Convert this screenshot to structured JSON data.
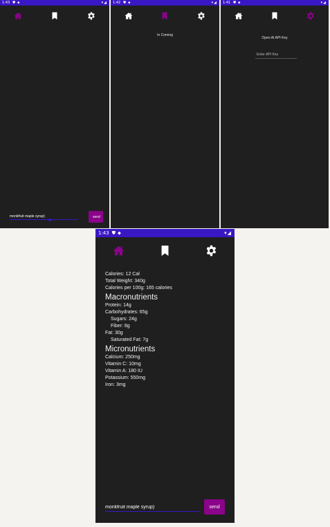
{
  "colors": {
    "status_bar": "#3a17c4",
    "background": "#1f1f1f",
    "accent": "#8a038a",
    "inactive_icon": "#ffffff",
    "page_bg": "#f4f3ef"
  },
  "screens": [
    {
      "status": {
        "time": "1:43",
        "left_icons": [
          "shield-icon",
          "location-icon"
        ],
        "right_icons": [
          "wifi-icon",
          "signal-icon"
        ]
      },
      "nav": {
        "active": "home"
      },
      "input_value": "monkfruit maple syrup)",
      "send_label": "send"
    },
    {
      "status": {
        "time": "1:42",
        "left_icons": [
          "shield-icon",
          "location-icon"
        ],
        "right_icons": [
          "wifi-icon",
          "signal-icon"
        ]
      },
      "nav": {
        "active": "bookmark"
      },
      "message": "In Coming"
    },
    {
      "status": {
        "time": "1:41",
        "left_icons": [
          "shield-icon",
          "location-icon"
        ],
        "right_icons": [
          "wifi-icon",
          "signal-icon"
        ]
      },
      "nav": {
        "active": "settings"
      },
      "api_label": "Open AI API Key",
      "api_placeholder": "Enter API Key"
    },
    {
      "status": {
        "time": "1:43",
        "left_icons": [
          "shield-icon",
          "location-icon"
        ],
        "right_icons": [
          "wifi-icon",
          "signal-icon"
        ]
      },
      "nav": {
        "active": "home"
      },
      "nutrition": {
        "calories": "Calories: 12 Cal",
        "total_weight": "Total Weight: 340g",
        "calories_per_100g": "Calories per 100g: 165 calories",
        "macro_heading": "Macronutrients",
        "protein": "Protein: 14g",
        "carbohydrates": "Carbohydrates: 65g",
        "sugars": "Sugars: 24g",
        "fiber": "Fiber: 8g",
        "fat": "Fat: 30g",
        "saturated_fat": "Saturated Fat: 7g",
        "micro_heading": "Micronutrients",
        "calcium": "Calcium: 250mg",
        "vitamin_c": "Vitamin C: 10mg",
        "vitamin_a": "Vitamin A: 180 IU",
        "potassium": "Potassium: 550mg",
        "iron": "Iron: 3mg"
      },
      "input_value": "monkfruit maple syrup)",
      "send_label": "send"
    }
  ]
}
